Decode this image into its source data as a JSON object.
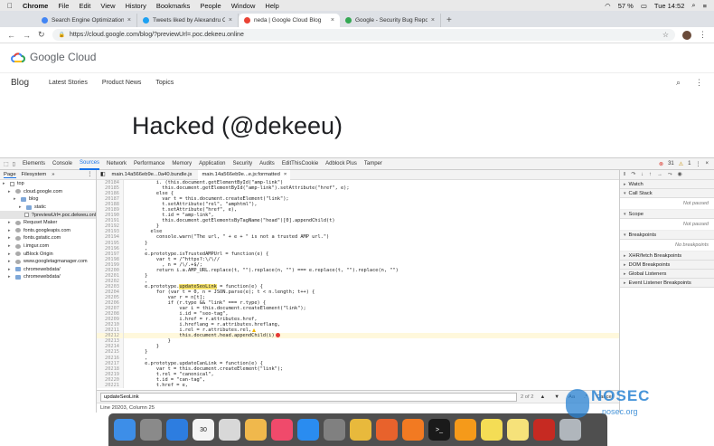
{
  "menubar": {
    "app": "Chrome",
    "items": [
      "File",
      "Edit",
      "View",
      "History",
      "Bookmarks",
      "People",
      "Window",
      "Help"
    ],
    "battery": "57 %",
    "clock": "Tue 14:52"
  },
  "tabs": [
    {
      "title": "Search Engine Optimization (S",
      "color": "#4285f4",
      "active": false
    },
    {
      "title": "Tweets liked by Alexandru Coh",
      "color": "#1da1f2",
      "active": false
    },
    {
      "title": "neda | Google Cloud Blog",
      "color": "#ea4335",
      "active": true
    },
    {
      "title": "Google - Security Bug Report",
      "color": "#34a853",
      "active": false
    }
  ],
  "address": {
    "url": "https://cloud.google.com/blog/?previewUrl=.poc.dekeeu.online"
  },
  "page": {
    "logo_text": "Google Cloud",
    "nav_title": "Blog",
    "nav_links": [
      "Latest Stories",
      "Product News",
      "Topics"
    ],
    "headline": "Hacked (@dekeeu)"
  },
  "devtools": {
    "tabs": [
      "Elements",
      "Console",
      "Sources",
      "Network",
      "Performance",
      "Memory",
      "Application",
      "Security",
      "Audits",
      "EditThisCookie",
      "Adblock Plus",
      "Tamper"
    ],
    "active_tab": "Sources",
    "errors": "31",
    "warnings": "1",
    "navigator_tabs": [
      "Page",
      "Filesystem"
    ],
    "tree": [
      {
        "label": "top",
        "depth": 0,
        "kind": "file",
        "sel": false
      },
      {
        "label": "cloud.google.com",
        "depth": 1,
        "kind": "cloud",
        "sel": false
      },
      {
        "label": "blog",
        "depth": 2,
        "kind": "folder",
        "sel": false
      },
      {
        "label": "static",
        "depth": 3,
        "kind": "folder",
        "sel": false
      },
      {
        "label": "?previewUrl=.poc.dekeeu.onl",
        "depth": 3,
        "kind": "file",
        "sel": true
      },
      {
        "label": "Requset Maker",
        "depth": 1,
        "kind": "cloud",
        "sel": false
      },
      {
        "label": "fonts.googleapis.com",
        "depth": 1,
        "kind": "cloud",
        "sel": false
      },
      {
        "label": "fonts.gstatic.com",
        "depth": 1,
        "kind": "cloud",
        "sel": false
      },
      {
        "label": "i.imgur.com",
        "depth": 1,
        "kind": "cloud",
        "sel": false
      },
      {
        "label": "uBlock Origin",
        "depth": 1,
        "kind": "cloud",
        "sel": false
      },
      {
        "label": "www.googletagmanager.com",
        "depth": 1,
        "kind": "cloud",
        "sel": false
      },
      {
        "label": "chromewebdata/",
        "depth": 1,
        "kind": "folder",
        "sel": false
      },
      {
        "label": "chromewebdata/",
        "depth": 1,
        "kind": "folder",
        "sel": false
      }
    ],
    "editor_tabs": [
      {
        "label": "main.14a566eb9e...0a40.bundle.js",
        "active": false
      },
      {
        "label": "main.14a566eb9e...e.js:formatted",
        "active": true
      }
    ],
    "code": [
      {
        "n": "20184",
        "t": "          i. (this.document.getElementById(\"amp-link\")",
        "hl": false
      },
      {
        "n": "20185",
        "t": "            this.document.getElementById(\"amp-link\").setAttribute(\"href\", e);",
        "hl": false
      },
      {
        "n": "20186",
        "t": "          else {",
        "hl": false
      },
      {
        "n": "20187",
        "t": "            var t = this.document.createElement(\"link\");",
        "hl": false
      },
      {
        "n": "20188",
        "t": "            t.setAttribute(\"rel\", \"amphtml\"),",
        "hl": false
      },
      {
        "n": "20189",
        "t": "            t.setAttribute(\"href\", e),",
        "hl": false
      },
      {
        "n": "20190",
        "t": "            t.id = \"amp-link\",",
        "hl": false
      },
      {
        "n": "20191",
        "t": "            this.document.getElementsByTagName(\"head\")[0].appendChild(t)",
        "hl": false
      },
      {
        "n": "20192",
        "t": "          }",
        "hl": false
      },
      {
        "n": "20193",
        "t": "        else",
        "hl": false
      },
      {
        "n": "20194",
        "t": "          console.warn(\"The url, \" + e + \" is not a trusted AMP url.\")",
        "hl": false
      },
      {
        "n": "20195",
        "t": "      }",
        "hl": false
      },
      {
        "n": "20196",
        "t": "      ,",
        "hl": false
      },
      {
        "n": "20197",
        "t": "      e.prototype.isTrustedAMPUrl = function(e) {",
        "hl": false
      },
      {
        "n": "20198",
        "t": "          var t = /^https?:\\/\\//",
        "hl": false
      },
      {
        "n": "20199",
        "t": "            , n = /\\/.+$/;",
        "hl": false
      },
      {
        "n": "20200",
        "t": "          return i.a.AMP_URL.replace(t, \"\").replace(n, \"\") === e.replace(t, \"\").replace(n, \"\")",
        "hl": false
      },
      {
        "n": "20201",
        "t": "      }",
        "hl": false
      },
      {
        "n": "20202",
        "t": "      ,",
        "hl": false
      },
      {
        "n": "20203",
        "t": "      e.prototype.",
        "mark": "updateSeoLink",
        "after": " = function(e) {",
        "hl": false
      },
      {
        "n": "20204",
        "t": "          for (var t = 0, n = JSON.parse(e); t < n.length; t++) {",
        "hl": false
      },
      {
        "n": "20205",
        "t": "              var r = n[t];",
        "hl": false
      },
      {
        "n": "20206",
        "t": "              if (r.type && \"link\" === r.type) {",
        "hl": false
      },
      {
        "n": "20207",
        "t": "                  var i = this.document.createElement(\"link\");",
        "hl": false
      },
      {
        "n": "20208",
        "t": "                  i.id = \"seo-tag\",",
        "hl": false
      },
      {
        "n": "20209",
        "t": "                  i.href = r.attributes.href,",
        "hl": false
      },
      {
        "n": "20210",
        "t": "                  i.hreflang = r.attributes.hreflang,",
        "hl": false
      },
      {
        "n": "20211",
        "t": "                  i.rel = r.attributes.rel,",
        "hl": false,
        "warn": true
      },
      {
        "n": "20212",
        "t": "                  this.document.head.appendChild(i)",
        "hl": true,
        "err": true
      },
      {
        "n": "20213",
        "t": "              }",
        "hl": false
      },
      {
        "n": "20214",
        "t": "          }",
        "hl": false
      },
      {
        "n": "20215",
        "t": "      }",
        "hl": false
      },
      {
        "n": "20216",
        "t": "      ,",
        "hl": false
      },
      {
        "n": "20217",
        "t": "      e.prototype.updateCanLink = function(e) {",
        "hl": false
      },
      {
        "n": "20218",
        "t": "          var t = this.document.createElement(\"link\");",
        "hl": false
      },
      {
        "n": "20219",
        "t": "          t.rel = \"canonical\",",
        "hl": false
      },
      {
        "n": "20220",
        "t": "          t.id = \"can-tag\",",
        "hl": false
      },
      {
        "n": "20221",
        "t": "          t.href = e,",
        "hl": false
      }
    ],
    "find_value": "updateSeoLink",
    "find_count": "2 of 2",
    "find_aa": "Aa",
    "find_regex": ".*",
    "find_cancel": "Cancel",
    "status": "Line 20203, Column 25",
    "debug_sections": [
      {
        "title": "Watch",
        "note": ""
      },
      {
        "title": "Call Stack",
        "note": "Not paused"
      },
      {
        "title": "Scope",
        "note": "Not paused"
      },
      {
        "title": "Breakpoints",
        "note": "No breakpoints"
      },
      {
        "title": "XHR/fetch Breakpoints",
        "note": ""
      },
      {
        "title": "DOM Breakpoints",
        "note": ""
      },
      {
        "title": "Global Listeners",
        "note": ""
      },
      {
        "title": "Event Listener Breakpoints",
        "note": ""
      }
    ]
  },
  "dock": [
    {
      "name": "finder-icon",
      "color": "#3d8ee8",
      "label": ""
    },
    {
      "name": "launchpad-icon",
      "color": "#8a8a8a",
      "label": ""
    },
    {
      "name": "safari-icon",
      "color": "#2d7de0",
      "label": ""
    },
    {
      "name": "calendar-icon",
      "color": "#f4f4f4",
      "label": "30"
    },
    {
      "name": "notes-icon",
      "color": "#d8d8d8",
      "label": ""
    },
    {
      "name": "photos-icon",
      "color": "#f0b84c",
      "label": ""
    },
    {
      "name": "music-icon",
      "color": "#f04a6b",
      "label": ""
    },
    {
      "name": "app-store-icon",
      "color": "#2a8cf0",
      "label": ""
    },
    {
      "name": "system-preferences-icon",
      "color": "#808080",
      "label": ""
    },
    {
      "name": "chrome-icon",
      "color": "#e8b93c",
      "label": ""
    },
    {
      "name": "burp-icon",
      "color": "#e8622c",
      "label": ""
    },
    {
      "name": "firefox-icon",
      "color": "#f27a22",
      "label": ""
    },
    {
      "name": "terminal-icon",
      "color": "#1a1a1a",
      "label": ">_"
    },
    {
      "name": "sublime-icon",
      "color": "#f59a1a",
      "label": ""
    },
    {
      "name": "stickies-icon",
      "color": "#f4dd55",
      "label": ""
    },
    {
      "name": "notes2-icon",
      "color": "#f6e27a",
      "label": ""
    },
    {
      "name": "filezilla-icon",
      "color": "#c62a22",
      "label": ""
    },
    {
      "name": "trash-icon",
      "color": "#b0b6bc",
      "label": ""
    }
  ],
  "watermark": {
    "line1": "NOSEC",
    "line2": "nosec.org"
  }
}
